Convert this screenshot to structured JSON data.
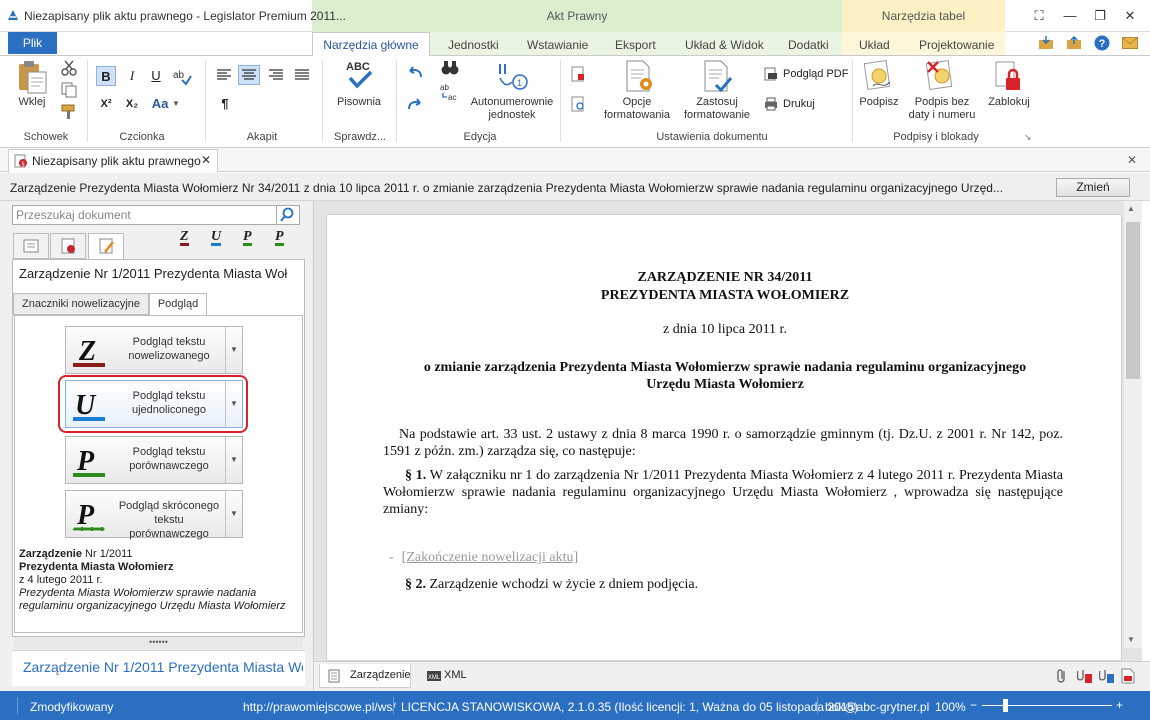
{
  "window": {
    "title": "Niezapisany plik aktu prawnego - Legislator Premium 2011..."
  },
  "context": {
    "akt_prawny": "Akt Prawny",
    "narzedzia_tabel": "Narzędzia tabel"
  },
  "ribbon_tabs": {
    "plik": "Plik",
    "narzedzia_glowne": "Narzędzia główne",
    "jednostki": "Jednostki",
    "wstawianie": "Wstawianie",
    "eksport": "Eksport",
    "uklad_widok": "Układ & Widok",
    "dodatki": "Dodatki",
    "uklad": "Układ",
    "projektowanie": "Projektowanie"
  },
  "groups": {
    "schowek": "Schowek",
    "czcionka": "Czcionka",
    "akapit": "Akapit",
    "sprawdz": "Sprawdz...",
    "edycja": "Edycja",
    "ustawienia": "Ustawienia dokumentu",
    "podpisy": "Podpisy i blokady"
  },
  "buttons": {
    "wklej": "Wklej",
    "pisownia": "Pisownia",
    "autonum_1": "Autonumerownie",
    "autonum_2": "jednostek",
    "opcje_1": "Opcje",
    "opcje_2": "formatowania",
    "zastosuj_1": "Zastosuj",
    "zastosuj_2": "formatowanie",
    "podglad_pdf": "Podgląd PDF",
    "drukuj": "Drukuj",
    "podpisz": "Podpisz",
    "podpis_bez_1": "Podpis bez",
    "podpis_bez_2": "daty i numeru",
    "zablokuj": "Zablokuj",
    "bold": "B",
    "italic": "I",
    "underline": "U",
    "superscript": "X²",
    "subscript": "X₂",
    "font_case": "Aa",
    "pilcrow": "¶"
  },
  "doc_tab": {
    "label": "Niezapisany plik aktu prawnego"
  },
  "doc_header": {
    "text": "Zarządzenie Prezydenta Miasta Wołomierz Nr 34/2011 z dnia 10 lipca 2011 r. o zmianie zarządzenia Prezydenta Miasta Wołomierzw sprawie nadania regulaminu organizacyjnego Urzęd...",
    "change_button": "Zmień"
  },
  "left": {
    "search_placeholder": "Przeszukaj dokument",
    "panel_title": "Zarządzenie Nr 1/2011 Prezydenta Miasta Woł",
    "subtabs": [
      "Znaczniki nowelizacyjne",
      "Podgląd"
    ],
    "preview_buttons": [
      {
        "line1": "Podgląd tekstu",
        "line2": "nowelizowanego",
        "letter": "Z",
        "color": "#8b1a1a"
      },
      {
        "line1": "Podgląd tekstu",
        "line2": "ujednoliconego",
        "letter": "U",
        "color": "#1c7fd4"
      },
      {
        "line1": "Podgląd tekstu",
        "line2": "porównawczego",
        "letter": "P",
        "color": "#2e8b1e"
      },
      {
        "line1": "Podgląd skróconego",
        "line2": "tekstu porównawczego",
        "letter": "P",
        "color": "#2e8b1e"
      }
    ],
    "info": {
      "type_bold": "Zarządzenie",
      "number": " Nr 1/2011",
      "author": "Prezydenta Miasta Wołomierz",
      "date": "z 4 lutego 2011 r.",
      "subject": "Prezydenta Miasta Wołomierzw sprawie nadania regulaminu organizacyjnego Urzędu Miasta Wołomierz"
    },
    "footer_link": "Zarządzenie Nr 1/2011 Prezydenta Miasta Wo"
  },
  "document": {
    "title1": "ZARZĄDZENIE NR 34/2011",
    "title2": "PREZYDENTA MIASTA WOŁOMIERZ",
    "date": "z dnia 10 lipca 2011 r.",
    "subject1": "o zmianie zarządzenia Prezydenta Miasta Wołomierzw sprawie nadania regulaminu organizacyjnego",
    "subject2": "Urzędu Miasta Wołomierz",
    "basis": "Na podstawie art. 33 ust. 2 ustawy z dnia 8 marca 1990 r. o samorządzie gminnym (tj. Dz.U. z 2001 r. Nr 142, poz. 1591 z późn. zm.) zarządza się, co następuje:",
    "par1_num": "§ 1.",
    "par1": " W załączniku nr 1 do zarządzenia Nr 1/2011 Prezydenta Miasta Wołomierz z 4 lutego 2011 r. Prezydenta Miasta Wołomierzw sprawie nadania regulaminu organizacyjnego Urzędu Miasta Wołomierz , wprowadza się następujące zmiany:",
    "end_marker": "[Zakończenie nowelizacji aktu]",
    "par2_num": "§ 2.",
    "par2": " Zarządzenie wchodzi w życie z dniem podjęcia."
  },
  "bottom_tabs": [
    "Zarządzenie",
    "XML"
  ],
  "status": {
    "state": "Zmodyfikowany",
    "url": "http://prawomiejscowe.pl/ws/",
    "license": "LICENCJA STANOWISKOWA, 2.1.0.35 (Ilość licencji: 1, Ważna do 05 listopada 2015)",
    "email": "bok@abc-grytner.pl",
    "zoom": "100%"
  },
  "colors": {
    "accent": "#2b6fc3",
    "highlight": "#d9232b"
  }
}
